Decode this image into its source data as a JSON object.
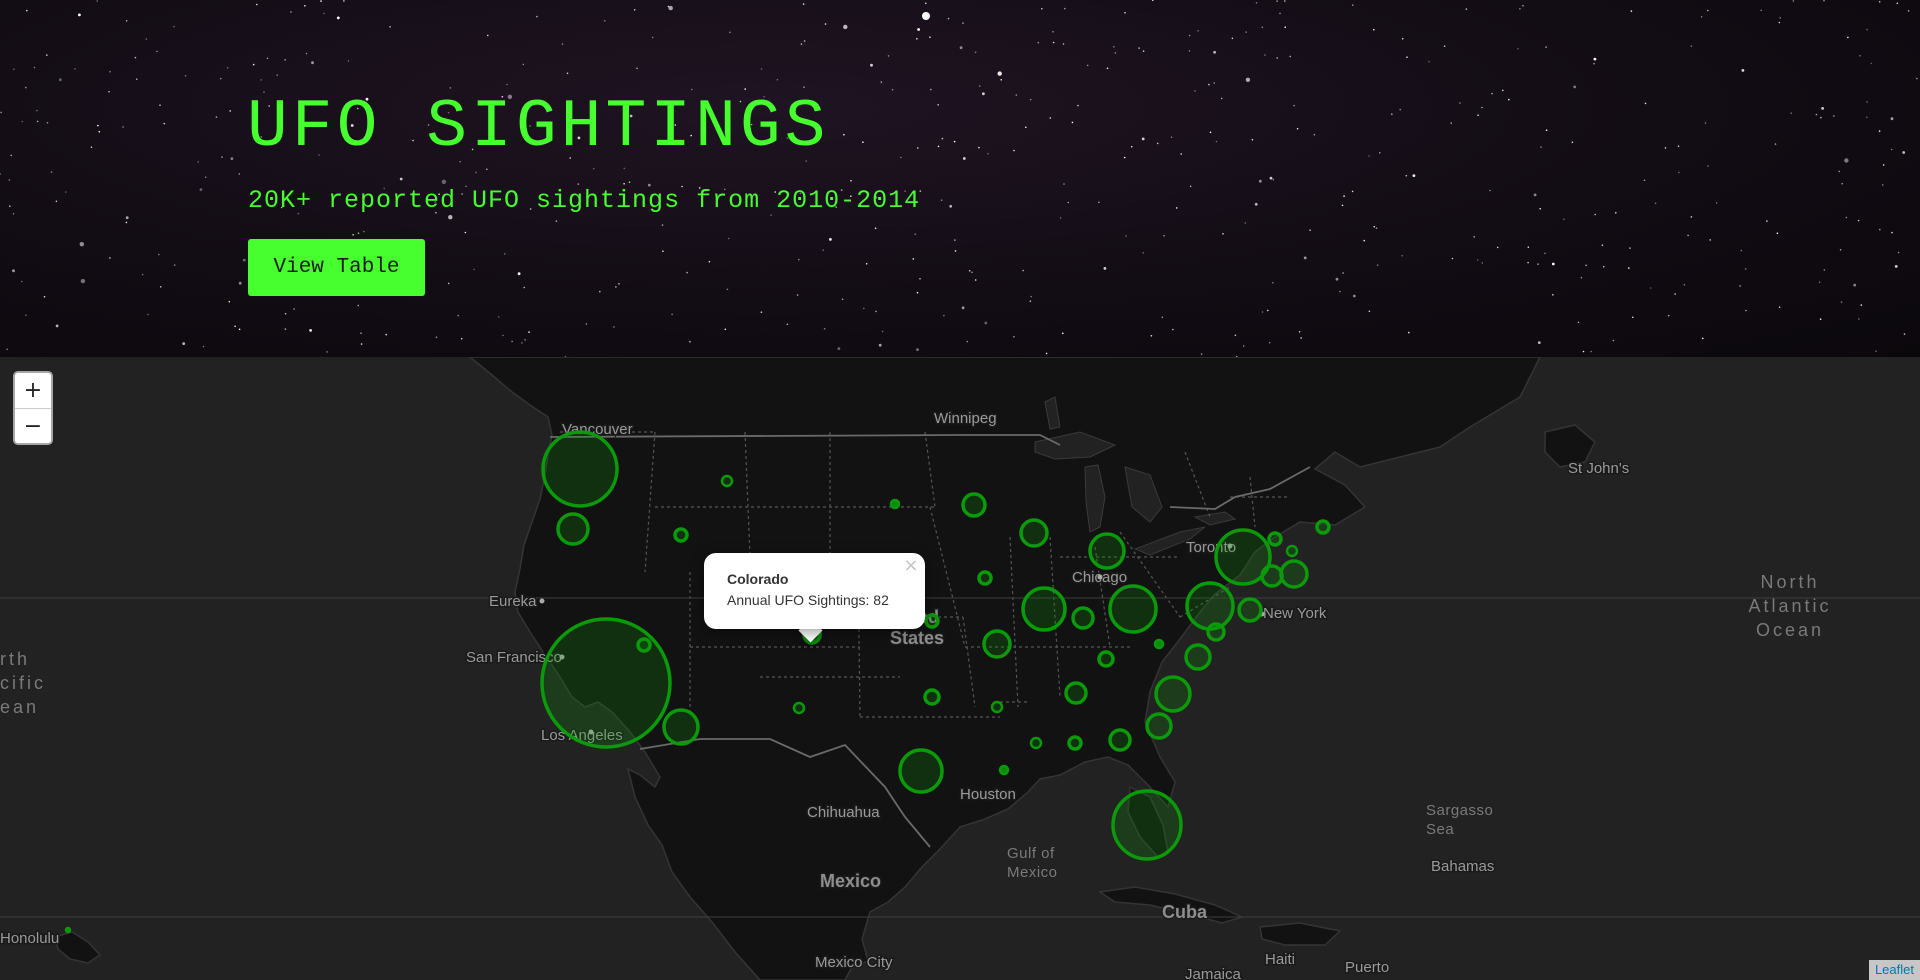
{
  "hero": {
    "title": "UFO SIGHTINGS",
    "subtitle": "20K+ reported UFO sightings from 2010-2014",
    "button_label": "View Table",
    "accent_color": "#47ff2e"
  },
  "map": {
    "zoom_in_label": "+",
    "zoom_out_label": "−",
    "attribution": "Leaflet",
    "marker_color": "#0a9a0a",
    "popup": {
      "state": "Colorado",
      "text": "Annual UFO Sightings: 82",
      "close_label": "×"
    },
    "places": [
      {
        "name": "Vancouver",
        "kind": "city"
      },
      {
        "name": "Winnipeg",
        "kind": "city"
      },
      {
        "name": "St John's",
        "kind": "city"
      },
      {
        "name": "Toronto",
        "kind": "city"
      },
      {
        "name": "Chicago",
        "kind": "city"
      },
      {
        "name": "New York",
        "kind": "city"
      },
      {
        "name": "Eureka",
        "kind": "city"
      },
      {
        "name": "San Francisco",
        "kind": "city"
      },
      {
        "name": "Los Angeles",
        "kind": "city"
      },
      {
        "name": "Houston",
        "kind": "city"
      },
      {
        "name": "Chihuahua",
        "kind": "city"
      },
      {
        "name": "Mexico City",
        "kind": "city"
      },
      {
        "name": "Honolulu",
        "kind": "city"
      },
      {
        "name": "Bahamas",
        "kind": "city"
      },
      {
        "name": "Haiti",
        "kind": "city"
      },
      {
        "name": "Jamaica",
        "kind": "city"
      },
      {
        "name": "Puerto",
        "kind": "city"
      },
      {
        "name": "Mexico",
        "kind": "country"
      },
      {
        "name": "Cuba",
        "kind": "country"
      },
      {
        "name": "ted",
        "kind": "country"
      },
      {
        "name": "States",
        "kind": "country"
      }
    ],
    "water_labels": [
      [
        "North",
        "Atlantic",
        "Ocean"
      ],
      [
        "rth",
        "cific",
        "ean"
      ],
      [
        "Gulf of",
        "Mexico"
      ],
      [
        "Sargasso",
        "Sea"
      ]
    ]
  }
}
